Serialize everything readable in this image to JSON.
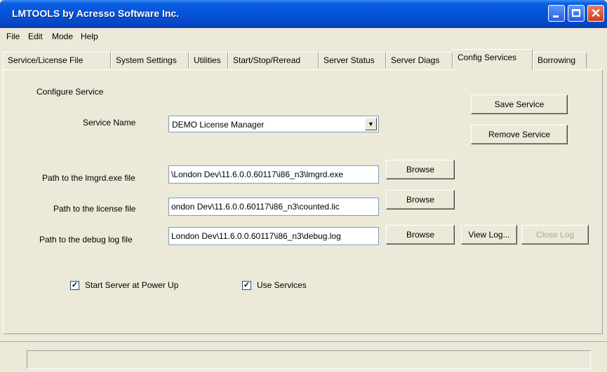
{
  "window": {
    "title": "LMTOOLS by Acresso Software Inc."
  },
  "menu": [
    "File",
    "Edit",
    "Mode",
    "Help"
  ],
  "tabs": [
    {
      "label": "Service/License File"
    },
    {
      "label": "System Settings"
    },
    {
      "label": "Utilities"
    },
    {
      "label": "Start/Stop/Reread"
    },
    {
      "label": "Server Status"
    },
    {
      "label": "Server Diags"
    },
    {
      "label": "Config Services"
    },
    {
      "label": "Borrowing"
    }
  ],
  "active_tab": "Config Services",
  "config": {
    "section_title": "Configure Service",
    "service_name_label": "Service Name",
    "service_name_value": "DEMO License Manager",
    "save_label": "Save Service",
    "remove_label": "Remove Service",
    "lmgrd_label": "Path to the lmgrd.exe file",
    "lmgrd_value": "\\London Dev\\11.6.0.0.60117\\i86_n3\\lmgrd.exe",
    "license_label": "Path to the license file",
    "license_value": "ondon Dev\\11.6.0.0.60117\\i86_n3\\counted.lic",
    "debug_label": "Path to the debug log file",
    "debug_value": "London Dev\\11.6.0.0.60117\\i86_n3\\debug.log",
    "browse_label": "Browse",
    "view_log_label": "View Log...",
    "close_log_label": "Close Log",
    "start_server_label": "Start Server at Power Up",
    "start_server_checked": true,
    "use_services_label": "Use Services",
    "use_services_checked": true
  },
  "status": {
    "text": ""
  },
  "icons": {
    "minimize": "minimize-icon",
    "maximize": "maximize-icon",
    "close": "close-icon",
    "dropdown": "chevron-down-icon",
    "checkmark": "checkmark-icon"
  }
}
